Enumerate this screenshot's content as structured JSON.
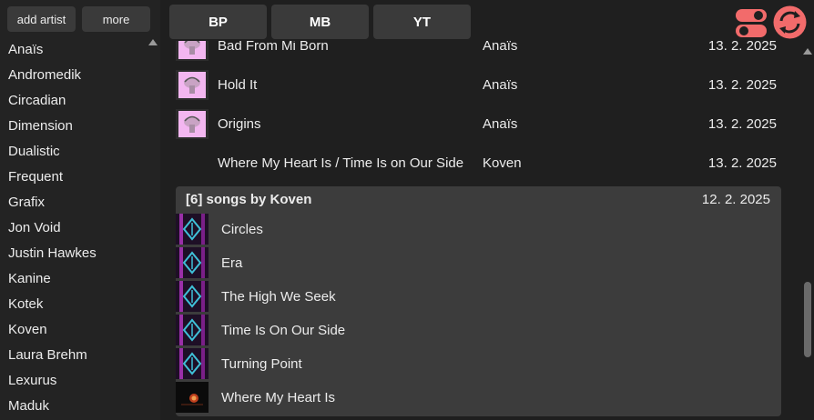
{
  "sidebar": {
    "add_artist_label": "add artist",
    "more_label": "more",
    "artists": [
      "Anaïs",
      "Andromedik",
      "Circadian",
      "Dimension",
      "Dualistic",
      "Frequent",
      "Grafix",
      "Jon Void",
      "Justin Hawkes",
      "Kanine",
      "Kotek",
      "Koven",
      "Laura Brehm",
      "Lexurus",
      "Maduk"
    ]
  },
  "topbar": {
    "buttons": [
      "BP",
      "MB",
      "YT"
    ],
    "icons": [
      "toggle-icon",
      "sync-icon"
    ],
    "accent": "#f26b6b"
  },
  "songs": [
    {
      "title": "Bad From Mi Born",
      "artist": "Anaïs",
      "date": "13. 2. 2025",
      "thumb": "pink"
    },
    {
      "title": "Hold It",
      "artist": "Anaïs",
      "date": "13. 2. 2025",
      "thumb": "pink"
    },
    {
      "title": "Origins",
      "artist": "Anaïs",
      "date": "13. 2. 2025",
      "thumb": "pink"
    },
    {
      "title": "Where My Heart Is / Time Is on Our Side",
      "artist": "Koven",
      "date": "13. 2. 2025",
      "thumb": "none"
    }
  ],
  "group": {
    "title": "[6] songs by Koven",
    "date": "12. 2. 2025",
    "songs": [
      {
        "title": "Circles",
        "thumb": "purple"
      },
      {
        "title": "Era",
        "thumb": "purple"
      },
      {
        "title": "The High We Seek",
        "thumb": "purple"
      },
      {
        "title": "Time Is On Our Side",
        "thumb": "purple"
      },
      {
        "title": "Turning Point",
        "thumb": "purple"
      },
      {
        "title": "Where My Heart Is",
        "thumb": "dark"
      }
    ]
  },
  "colors": {
    "background": "#1f1f1f",
    "sidebar": "#232323",
    "card": "#3c3c3c",
    "button": "#3a3a3a"
  }
}
